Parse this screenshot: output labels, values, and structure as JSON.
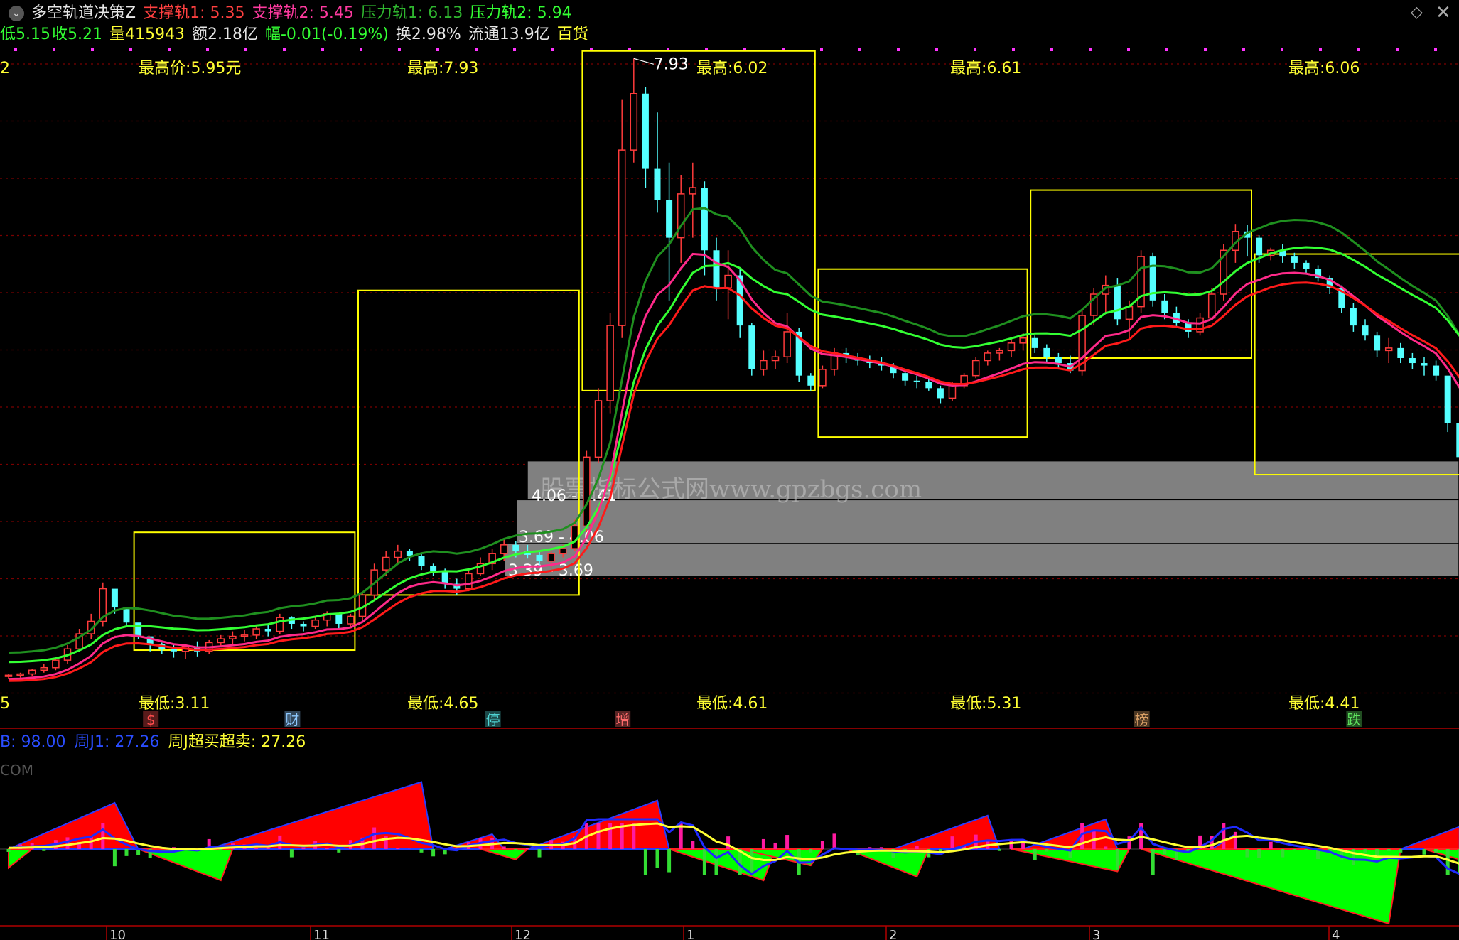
{
  "header": {
    "indicator_name": "多空轨道决策Z",
    "support1": "支撑轨1: 5.35",
    "support2": "支撑轨2: 5.45",
    "pressure1": "压力轨1: 6.13",
    "pressure2": "压力轨2: 5.94",
    "low": "低5.15",
    "close": "收5.21",
    "volume": "量415943",
    "amount": "额2.18亿",
    "change": "幅-0.01(-0.19%)",
    "turnover": "换2.98%",
    "float": "流通13.9亿",
    "sector": "百货"
  },
  "colors": {
    "bull_candle": "#ff3b3b",
    "bear_candle": "#54ffff",
    "support_line1": "#ff1a1a",
    "support_line2": "#ff2a8a",
    "pressure_line1": "#1f8f1f",
    "pressure_line2": "#33ff33",
    "box": "#ffff00",
    "zone": "#808080",
    "red_area": "#ff0000",
    "green_area": "#00ff00"
  },
  "subheader": {
    "b_label": "B: 98.00",
    "j1_label": "周J1: 27.26",
    "jdx_label": "周J超买超卖: 27.26"
  },
  "site_tag": "COM",
  "watermark": "股票指标公式网www.gpzbgs.com",
  "chart_data": {
    "type": "candlestick",
    "price_range": [
      2.7,
      8.0
    ],
    "axis_edge_labels": {
      "top": "2",
      "bottom": "5"
    },
    "x_month_labels": [
      "10",
      "11",
      "12",
      "1",
      "2",
      "3",
      "4"
    ],
    "peak_label": "7.93",
    "high_labels": [
      "最高价:5.95元",
      "最高:7.93",
      "最高:6.02",
      "最高:6.61",
      "最高:6.06"
    ],
    "low_labels": [
      "最低:3.11",
      "最低:4.65",
      "最低:4.61",
      "最低:5.31",
      "最低:4.41"
    ],
    "zones": [
      {
        "label": "",
        "low": 4.41,
        "high": 4.72
      },
      {
        "label": "4.06 - 4.41",
        "low": 4.06,
        "high": 4.41
      },
      {
        "label": "3.69 - 4.06",
        "low": 3.8,
        "high": 4.06
      },
      {
        "label": "3.39 - 3.69",
        "low": null,
        "high": null
      }
    ],
    "boxes": [
      {
        "start": 11,
        "end": 29,
        "high": 4.15,
        "low": 3.21
      },
      {
        "start": 30,
        "end": 48,
        "high": 6.08,
        "low": 3.65
      },
      {
        "start": 49,
        "end": 68,
        "high": 7.99,
        "low": 5.28
      },
      {
        "start": 69,
        "end": 86,
        "high": 6.25,
        "low": 4.91
      },
      {
        "start": 87,
        "end": 105,
        "high": 6.88,
        "low": 5.54
      },
      {
        "start": 106,
        "end": 123,
        "high": 6.37,
        "low": 4.61
      }
    ],
    "event_tags": [
      {
        "i": 12,
        "label": "$",
        "color": "#ff4d4d"
      },
      {
        "i": 24,
        "label": "财",
        "color": "#8ec9ff"
      },
      {
        "i": 41,
        "label": "停",
        "color": "#4fd3d3"
      },
      {
        "i": 52,
        "label": "增",
        "color": "#ff6b6b"
      },
      {
        "i": 96,
        "label": "榜",
        "color": "#d9a066"
      },
      {
        "i": 114,
        "label": "跌",
        "color": "#5ee05e"
      }
    ],
    "candles_ohlc": [
      [
        3.0,
        3.02,
        2.98,
        3.01
      ],
      [
        3.01,
        3.03,
        2.99,
        3.02
      ],
      [
        3.02,
        3.06,
        3.0,
        3.05
      ],
      [
        3.05,
        3.1,
        3.03,
        3.07
      ],
      [
        3.07,
        3.15,
        3.05,
        3.13
      ],
      [
        3.13,
        3.25,
        3.1,
        3.22
      ],
      [
        3.22,
        3.38,
        3.2,
        3.34
      ],
      [
        3.34,
        3.5,
        3.3,
        3.44
      ],
      [
        3.44,
        3.75,
        3.4,
        3.7
      ],
      [
        3.7,
        3.62,
        3.5,
        3.55
      ],
      [
        3.55,
        3.5,
        3.4,
        3.43
      ],
      [
        3.43,
        3.36,
        3.3,
        3.32
      ],
      [
        3.32,
        3.3,
        3.2,
        3.26
      ],
      [
        3.26,
        3.27,
        3.18,
        3.22
      ],
      [
        3.22,
        3.25,
        3.15,
        3.2
      ],
      [
        3.2,
        3.26,
        3.14,
        3.24
      ],
      [
        3.24,
        3.28,
        3.16,
        3.2
      ],
      [
        3.2,
        3.29,
        3.18,
        3.27
      ],
      [
        3.27,
        3.33,
        3.24,
        3.3
      ],
      [
        3.3,
        3.36,
        3.26,
        3.32
      ],
      [
        3.32,
        3.37,
        3.28,
        3.33
      ],
      [
        3.33,
        3.4,
        3.3,
        3.38
      ],
      [
        3.38,
        3.42,
        3.32,
        3.36
      ],
      [
        3.36,
        3.5,
        3.34,
        3.47
      ],
      [
        3.47,
        3.48,
        3.38,
        3.42
      ],
      [
        3.42,
        3.44,
        3.36,
        3.4
      ],
      [
        3.4,
        3.48,
        3.38,
        3.45
      ],
      [
        3.45,
        3.52,
        3.4,
        3.5
      ],
      [
        3.5,
        3.48,
        3.38,
        3.42
      ],
      [
        3.42,
        3.5,
        3.4,
        3.48
      ],
      [
        3.48,
        3.68,
        3.45,
        3.65
      ],
      [
        3.65,
        3.9,
        3.6,
        3.85
      ],
      [
        3.85,
        4.0,
        3.8,
        3.95
      ],
      [
        3.95,
        4.05,
        3.9,
        4.0
      ],
      [
        4.0,
        4.02,
        3.92,
        3.96
      ],
      [
        3.96,
        3.98,
        3.85,
        3.88
      ],
      [
        3.88,
        3.9,
        3.8,
        3.84
      ],
      [
        3.84,
        3.86,
        3.7,
        3.74
      ],
      [
        3.74,
        3.78,
        3.65,
        3.7
      ],
      [
        3.7,
        3.85,
        3.68,
        3.82
      ],
      [
        3.82,
        3.95,
        3.8,
        3.9
      ],
      [
        3.9,
        4.02,
        3.85,
        3.98
      ],
      [
        3.98,
        4.1,
        3.92,
        4.05
      ],
      [
        4.05,
        4.08,
        3.95,
        4.0
      ],
      [
        4.0,
        4.05,
        3.94,
        3.97
      ],
      [
        3.97,
        4.0,
        3.88,
        3.92
      ],
      [
        3.92,
        4.0,
        3.86,
        3.98
      ],
      [
        3.98,
        4.05,
        3.95,
        4.02
      ],
      [
        4.02,
        4.25,
        4.0,
        4.2
      ],
      [
        4.2,
        4.8,
        4.15,
        4.75
      ],
      [
        4.75,
        5.3,
        4.7,
        5.2
      ],
      [
        5.2,
        5.9,
        5.1,
        5.8
      ],
      [
        5.8,
        7.6,
        5.7,
        7.2
      ],
      [
        7.2,
        7.93,
        7.1,
        7.65
      ],
      [
        7.65,
        7.7,
        6.9,
        7.05
      ],
      [
        7.05,
        7.5,
        6.7,
        6.8
      ],
      [
        6.8,
        7.1,
        6.0,
        6.5
      ],
      [
        6.5,
        7.0,
        6.3,
        6.85
      ],
      [
        6.85,
        7.1,
        6.5,
        6.9
      ],
      [
        6.9,
        6.95,
        6.2,
        6.4
      ],
      [
        6.4,
        6.5,
        6.0,
        6.1
      ],
      [
        6.1,
        6.4,
        5.85,
        6.2
      ],
      [
        6.2,
        6.25,
        5.7,
        5.8
      ],
      [
        5.8,
        5.82,
        5.4,
        5.45
      ],
      [
        5.45,
        5.6,
        5.4,
        5.52
      ],
      [
        5.52,
        5.6,
        5.45,
        5.55
      ],
      [
        5.55,
        5.9,
        5.5,
        5.75
      ],
      [
        5.75,
        5.78,
        5.35,
        5.4
      ],
      [
        5.4,
        5.42,
        5.28,
        5.32
      ],
      [
        5.32,
        5.48,
        5.3,
        5.45
      ],
      [
        5.45,
        5.62,
        5.4,
        5.58
      ],
      [
        5.58,
        5.62,
        5.5,
        5.55
      ],
      [
        5.55,
        5.58,
        5.48,
        5.52
      ],
      [
        5.52,
        5.56,
        5.46,
        5.5
      ],
      [
        5.5,
        5.55,
        5.44,
        5.48
      ],
      [
        5.48,
        5.5,
        5.38,
        5.42
      ],
      [
        5.42,
        5.44,
        5.32,
        5.36
      ],
      [
        5.36,
        5.4,
        5.3,
        5.35
      ],
      [
        5.35,
        5.38,
        5.28,
        5.3
      ],
      [
        5.3,
        5.32,
        5.18,
        5.22
      ],
      [
        5.22,
        5.35,
        5.2,
        5.32
      ],
      [
        5.32,
        5.42,
        5.3,
        5.4
      ],
      [
        5.4,
        5.55,
        5.38,
        5.52
      ],
      [
        5.52,
        5.6,
        5.48,
        5.58
      ],
      [
        5.58,
        5.62,
        5.52,
        5.6
      ],
      [
        5.6,
        5.7,
        5.55,
        5.66
      ],
      [
        5.66,
        5.74,
        5.6,
        5.7
      ],
      [
        5.7,
        5.72,
        5.58,
        5.62
      ],
      [
        5.62,
        5.65,
        5.5,
        5.55
      ],
      [
        5.55,
        5.58,
        5.46,
        5.5
      ],
      [
        5.5,
        5.56,
        5.42,
        5.44
      ],
      [
        5.44,
        5.92,
        5.4,
        5.88
      ],
      [
        5.88,
        6.1,
        5.8,
        6.05
      ],
      [
        6.05,
        6.2,
        5.9,
        6.12
      ],
      [
        6.12,
        6.18,
        5.8,
        5.85
      ],
      [
        5.85,
        6.0,
        5.7,
        5.95
      ],
      [
        5.95,
        6.4,
        5.9,
        6.35
      ],
      [
        6.35,
        6.38,
        5.95,
        6.0
      ],
      [
        6.0,
        6.05,
        5.85,
        5.9
      ],
      [
        5.9,
        5.95,
        5.78,
        5.82
      ],
      [
        5.82,
        5.85,
        5.7,
        5.75
      ],
      [
        5.75,
        5.9,
        5.72,
        5.86
      ],
      [
        5.86,
        6.1,
        5.84,
        6.05
      ],
      [
        6.05,
        6.45,
        6.0,
        6.4
      ],
      [
        6.4,
        6.61,
        6.3,
        6.55
      ],
      [
        6.55,
        6.6,
        6.35,
        6.5
      ],
      [
        6.5,
        6.52,
        6.3,
        6.36
      ],
      [
        6.36,
        6.42,
        6.32,
        6.4
      ],
      [
        6.4,
        6.45,
        6.3,
        6.35
      ],
      [
        6.35,
        6.38,
        6.25,
        6.3
      ],
      [
        6.3,
        6.32,
        6.22,
        6.25
      ],
      [
        6.25,
        6.28,
        6.15,
        6.18
      ],
      [
        6.18,
        6.2,
        6.05,
        6.1
      ],
      [
        6.1,
        6.12,
        5.9,
        5.94
      ],
      [
        5.94,
        5.98,
        5.75,
        5.8
      ],
      [
        5.8,
        5.85,
        5.68,
        5.72
      ],
      [
        5.72,
        5.75,
        5.55,
        5.6
      ],
      [
        5.6,
        5.7,
        5.5,
        5.62
      ],
      [
        5.62,
        5.66,
        5.5,
        5.54
      ],
      [
        5.54,
        5.58,
        5.45,
        5.5
      ],
      [
        5.5,
        5.55,
        5.4,
        5.48
      ],
      [
        5.48,
        5.52,
        5.36,
        5.4
      ],
      [
        5.4,
        5.12,
        4.95,
        5.02
      ],
      [
        5.02,
        5.0,
        4.7,
        4.75
      ],
      [
        4.75,
        5.4,
        4.41,
        5.25
      ],
      [
        5.25,
        5.7,
        5.2,
        5.6
      ],
      [
        5.6,
        5.72,
        5.45,
        5.5
      ],
      [
        5.5,
        5.68,
        5.42,
        5.55
      ],
      [
        5.55,
        5.7,
        5.4,
        5.45
      ],
      [
        5.45,
        5.55,
        5.3,
        5.38
      ],
      [
        5.38,
        5.5,
        5.15,
        5.21
      ]
    ],
    "oscillator": {
      "range": [
        -1.0,
        1.0
      ],
      "red_peaks": [
        {
          "start": 0,
          "peak": 9,
          "end": 11,
          "value": 0.62
        },
        {
          "start": 17,
          "peak": 35,
          "end": 36,
          "value": 0.9
        },
        {
          "start": 37,
          "peak": 41,
          "end": 42,
          "value": 0.2
        },
        {
          "start": 44,
          "peak": 55,
          "end": 56,
          "value": 0.65
        },
        {
          "start": 75,
          "peak": 83,
          "end": 84,
          "value": 0.45
        },
        {
          "start": 86,
          "peak": 93,
          "end": 94,
          "value": 0.4
        },
        {
          "start": 102,
          "peak": 104,
          "end": 104,
          "value": 0.2
        },
        {
          "start": 118,
          "peak": 123,
          "end": 123,
          "value": 0.3
        }
      ],
      "green_troughs": [
        {
          "start": 0,
          "trough": 0,
          "end": 2,
          "value": -0.25
        },
        {
          "start": 11,
          "trough": 18,
          "end": 19,
          "value": -0.42
        },
        {
          "start": 40,
          "trough": 43,
          "end": 44,
          "value": -0.14
        },
        {
          "start": 56,
          "trough": 64,
          "end": 65,
          "value": -0.42
        },
        {
          "start": 62,
          "trough": 68,
          "end": 69,
          "value": -0.22
        },
        {
          "start": 71,
          "trough": 77,
          "end": 78,
          "value": -0.37
        },
        {
          "start": 85,
          "trough": 94,
          "end": 95,
          "value": -0.3
        },
        {
          "start": 96,
          "trough": 117,
          "end": 118,
          "value": -1.0
        },
        {
          "start": 120,
          "trough": 123,
          "end": 123,
          "value": -0.14
        }
      ]
    }
  }
}
